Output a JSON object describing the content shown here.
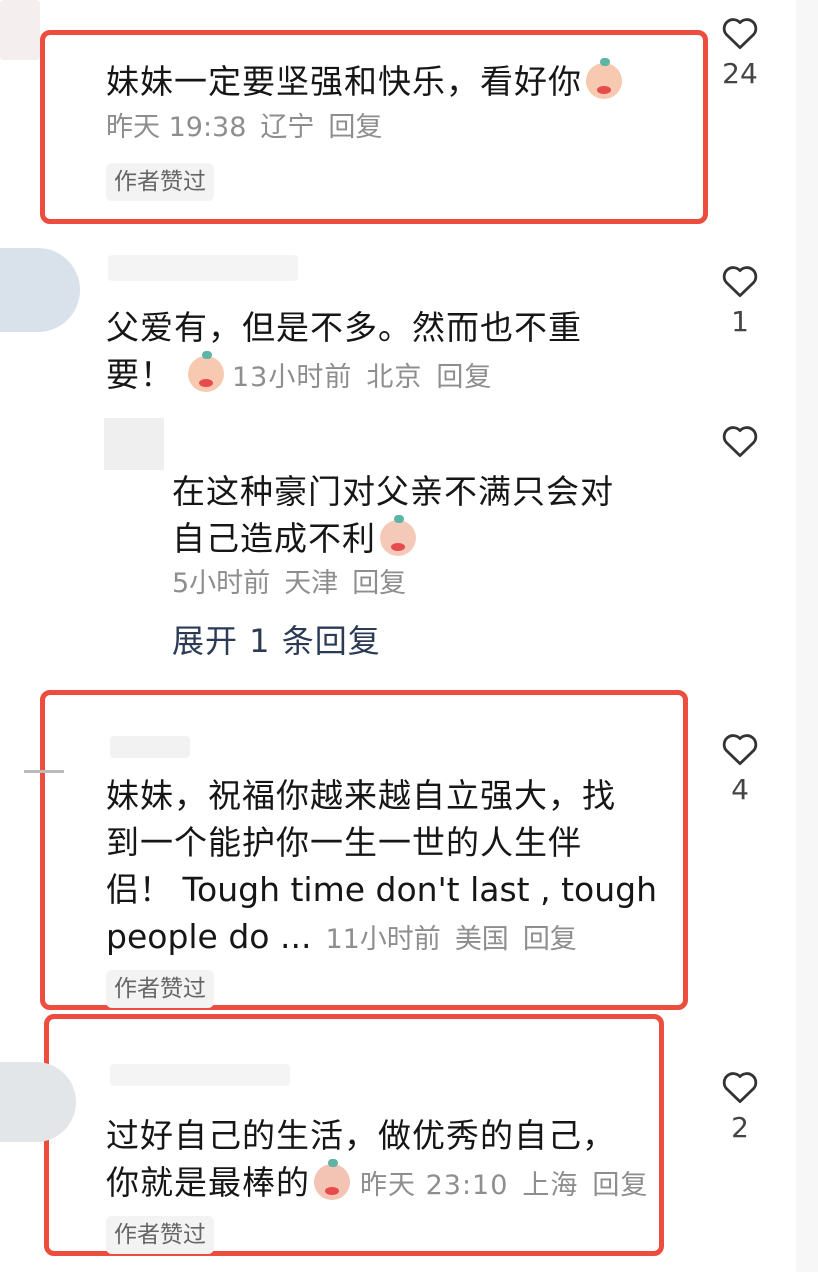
{
  "comments": [
    {
      "text": "妹妹一定要坚强和快乐，看好你",
      "time": "昨天 19:38",
      "location": "辽宁",
      "reply_label": "回复",
      "badge": "作者赞过",
      "likes": "24",
      "emoji": "blushing-baby-emoji"
    },
    {
      "text_line1": "父爱有，但是不多。然而也不重",
      "text_line2": "要！",
      "time": "13小时前",
      "location": "北京",
      "reply_label": "回复",
      "likes": "1",
      "emoji": "blushing-baby-emoji"
    },
    {
      "text_line1": "在这种豪门对父亲不满只会对",
      "text_line2": "自己造成不利",
      "time": "5小时前",
      "location": "天津",
      "reply_label": "回复",
      "expand_label": "展开 1 条回复",
      "emoji": "crying-emoji"
    },
    {
      "text_line1": "妹妹，祝福你越来越自立强大，找",
      "text_line2": "到一个能护你一生一世的人生伴",
      "text_line3": "侣！ Tough time don't last , tough",
      "text_line4": "people do ...",
      "time": "11小时前",
      "location": "美国",
      "reply_label": "回复",
      "badge": "作者赞过",
      "likes": "4"
    },
    {
      "text_line1": "过好自己的生活，做优秀的自己，",
      "text_line2": "你就是最棒的",
      "time": "昨天 23:10",
      "location": "上海",
      "reply_label": "回复",
      "badge": "作者赞过",
      "likes": "2",
      "emoji": "grimacing-emoji"
    }
  ],
  "colors": {
    "highlight_border": "#ec4d3f",
    "meta_text": "#8e8e8e",
    "expand_text": "#2b3a55"
  }
}
